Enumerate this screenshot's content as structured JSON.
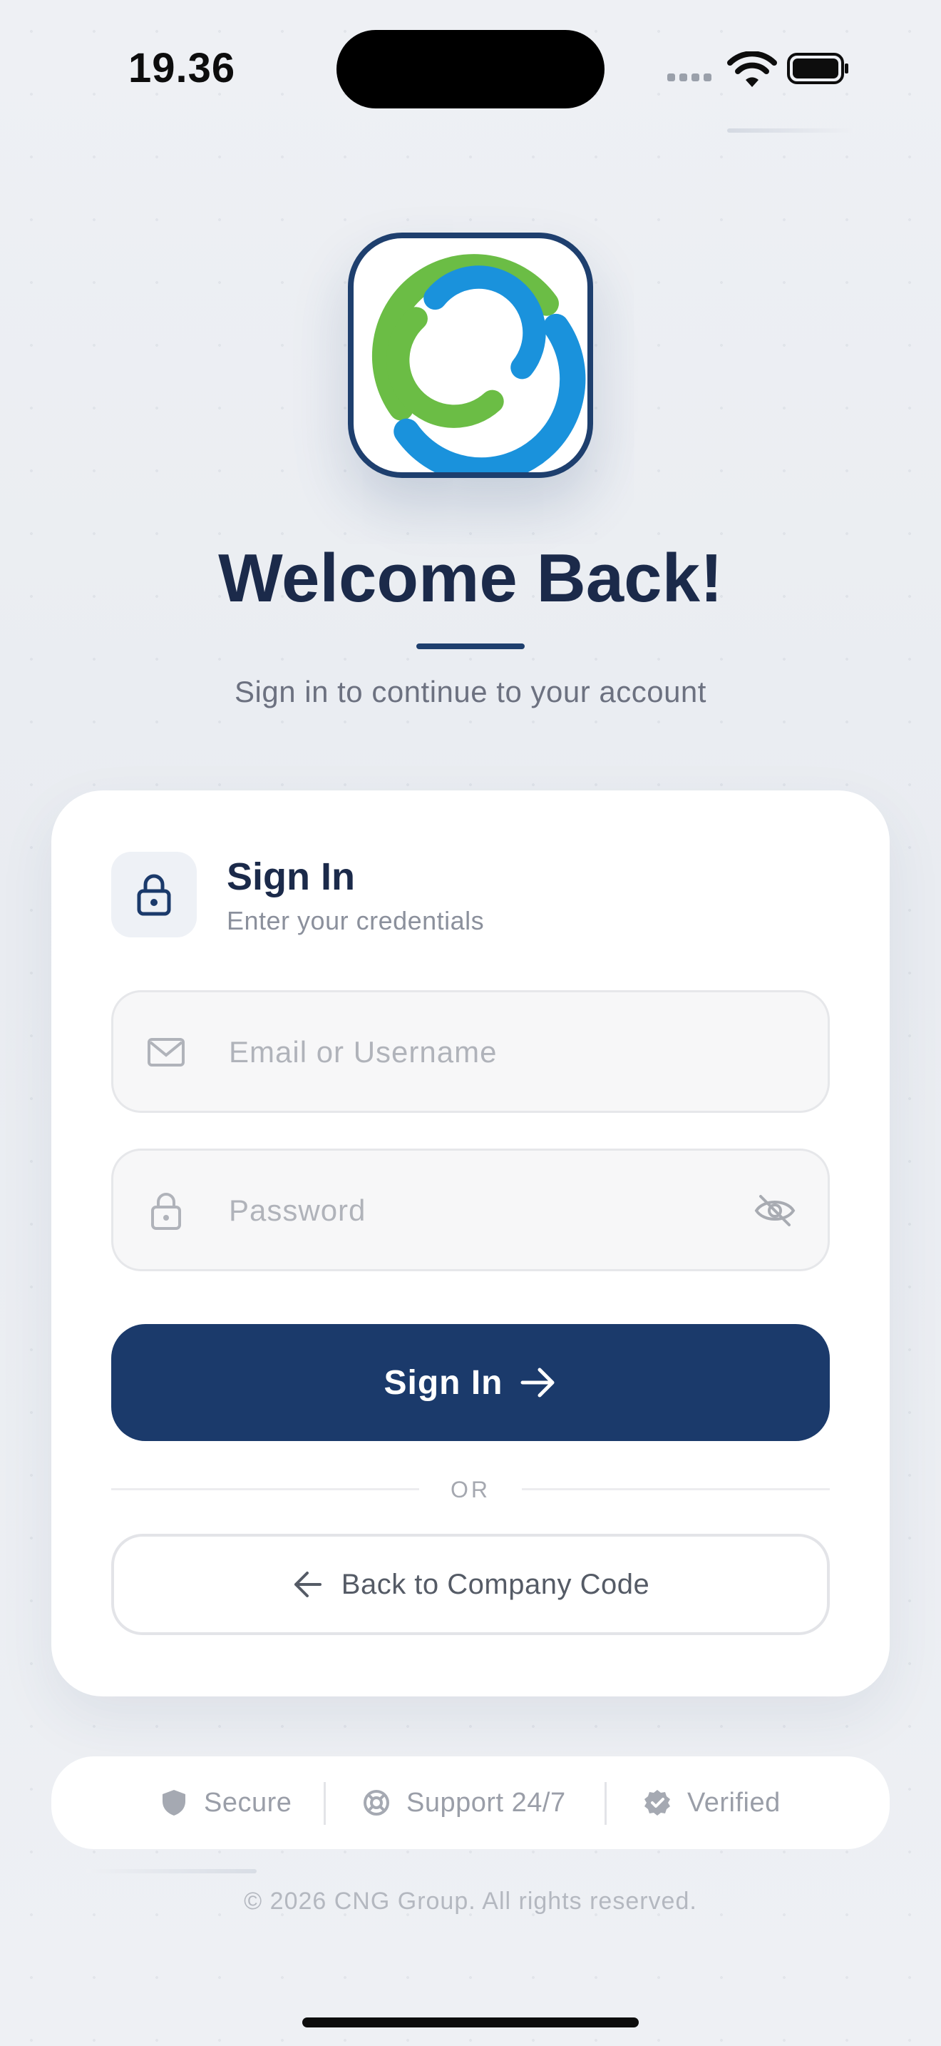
{
  "status_bar": {
    "time": "19.36"
  },
  "header": {
    "title": "Welcome Back!",
    "subtitle": "Sign in to continue to your account"
  },
  "card": {
    "title": "Sign In",
    "subtitle": "Enter your credentials",
    "email_placeholder": "Email or Username",
    "password_placeholder": "Password",
    "sign_in_label": "Sign In",
    "or_label": "OR",
    "back_label": "Back to Company Code"
  },
  "trust": {
    "items": [
      {
        "label": "Secure",
        "icon": "shield-icon"
      },
      {
        "label": "Support 24/7",
        "icon": "support-icon"
      },
      {
        "label": "Verified",
        "icon": "verified-badge-icon"
      }
    ]
  },
  "footer": {
    "copyright": "© 2026 CNG Group. All rights reserved."
  },
  "colors": {
    "primary": "#1b3a6b",
    "logo_green": "#6bbd45",
    "logo_blue": "#1a92dc",
    "title": "#1b2a4a"
  }
}
